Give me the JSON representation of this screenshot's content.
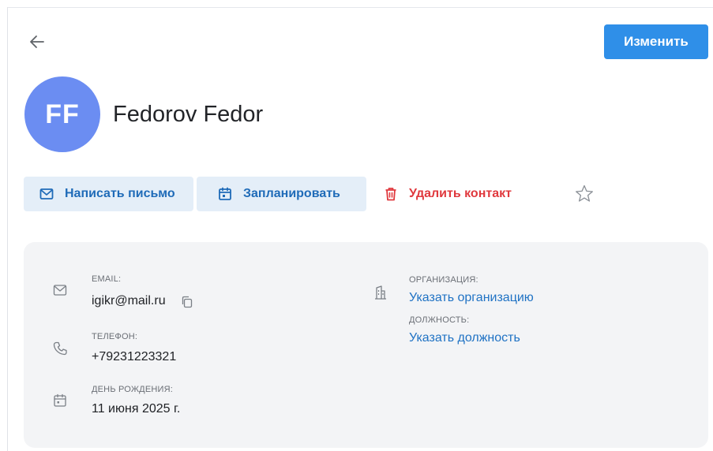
{
  "header": {
    "edit_label": "Изменить"
  },
  "contact": {
    "initials": "FF",
    "name": "Fedorov Fedor",
    "avatar_color": "#6b8df2"
  },
  "actions": {
    "write_label": "Написать письмо",
    "plan_label": "Запланировать",
    "delete_label": "Удалить контакт"
  },
  "details": {
    "email_label": "EMAIL:",
    "email_value": "igikr@mail.ru",
    "phone_label": "ТЕЛЕФОН:",
    "phone_value": "+79231223321",
    "birthday_label": "ДЕНЬ РОЖДЕНИЯ:",
    "birthday_value": "11 июня 2025 г.",
    "org_label": "ОРГАНИЗАЦИЯ:",
    "org_link": "Указать организацию",
    "position_label": "ДОЛЖНОСТЬ:",
    "position_link": "Указать должность"
  },
  "icons": {
    "back": "arrow-left-icon",
    "mail": "envelope-icon",
    "calendar": "calendar-icon",
    "trash": "trash-icon",
    "star": "star-icon",
    "copy": "copy-icon",
    "phone": "phone-icon",
    "building": "building-icon"
  },
  "colors": {
    "primary": "#2f8fe8",
    "secondary_bg": "#e4eef8",
    "secondary_text": "#1f6bb8",
    "danger": "#e0393e",
    "link": "#1f72c4",
    "card_bg": "#f3f4f6"
  }
}
